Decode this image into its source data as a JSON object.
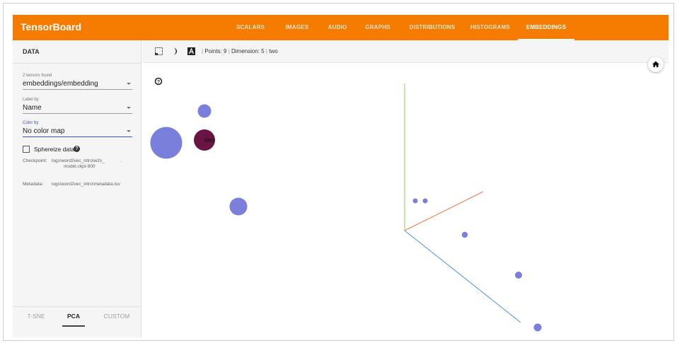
{
  "app": {
    "title": "TensorBoard"
  },
  "nav": {
    "tabs": [
      {
        "label": "SCALARS",
        "active": false
      },
      {
        "label": "IMAGES",
        "active": false
      },
      {
        "label": "AUDIO",
        "active": false
      },
      {
        "label": "GRAPHS",
        "active": false
      },
      {
        "label": "DISTRIBUTIONS",
        "active": false
      },
      {
        "label": "HISTOGRAMS",
        "active": false
      },
      {
        "label": "EMBEDDINGS",
        "active": true
      }
    ]
  },
  "left_panel": {
    "section_title": "DATA",
    "tensors_found": "2 tensors found",
    "tensor_select_value": "embeddings/embedding",
    "label_by_label": "Label by",
    "label_by_value": "Name",
    "color_by_label": "Color by",
    "color_by_value": "No color map",
    "sphereize_label": "Sphereize data",
    "sphereize_checked": false,
    "checkpoint_key": "Checkpoint:",
    "checkpoint_line1": "logs\\word2vec_intro\\w2v_",
    "checkpoint_line2": "model.ckpt-900",
    "metadata_key": "Metadata:",
    "metadata_value": "logs\\word2vec_intro\\metadata.tsv",
    "projection_tabs": [
      {
        "label": "T-SNE",
        "active": false
      },
      {
        "label": "PCA",
        "active": true
      },
      {
        "label": "CUSTOM",
        "active": false
      }
    ]
  },
  "toolbar": {
    "icons": [
      "select-rectangle-icon",
      "night-mode-icon",
      "label-toggle-icon"
    ],
    "points_text": "Points: 9",
    "dimension_text": "Dimension: 5",
    "selected_text": "two"
  },
  "scene": {
    "help_icon": "help-circle-icon",
    "home_icon": "home-icon",
    "selected_point_label": "two",
    "point_color": "#7b7fdc",
    "selected_point_color": "#6a1446",
    "axis_colors": {
      "x": "#4a90e2",
      "y": "#7ed957",
      "z": "#f5793b"
    }
  },
  "colors": {
    "header": "#f57c00",
    "accent": "#3f51b5"
  }
}
